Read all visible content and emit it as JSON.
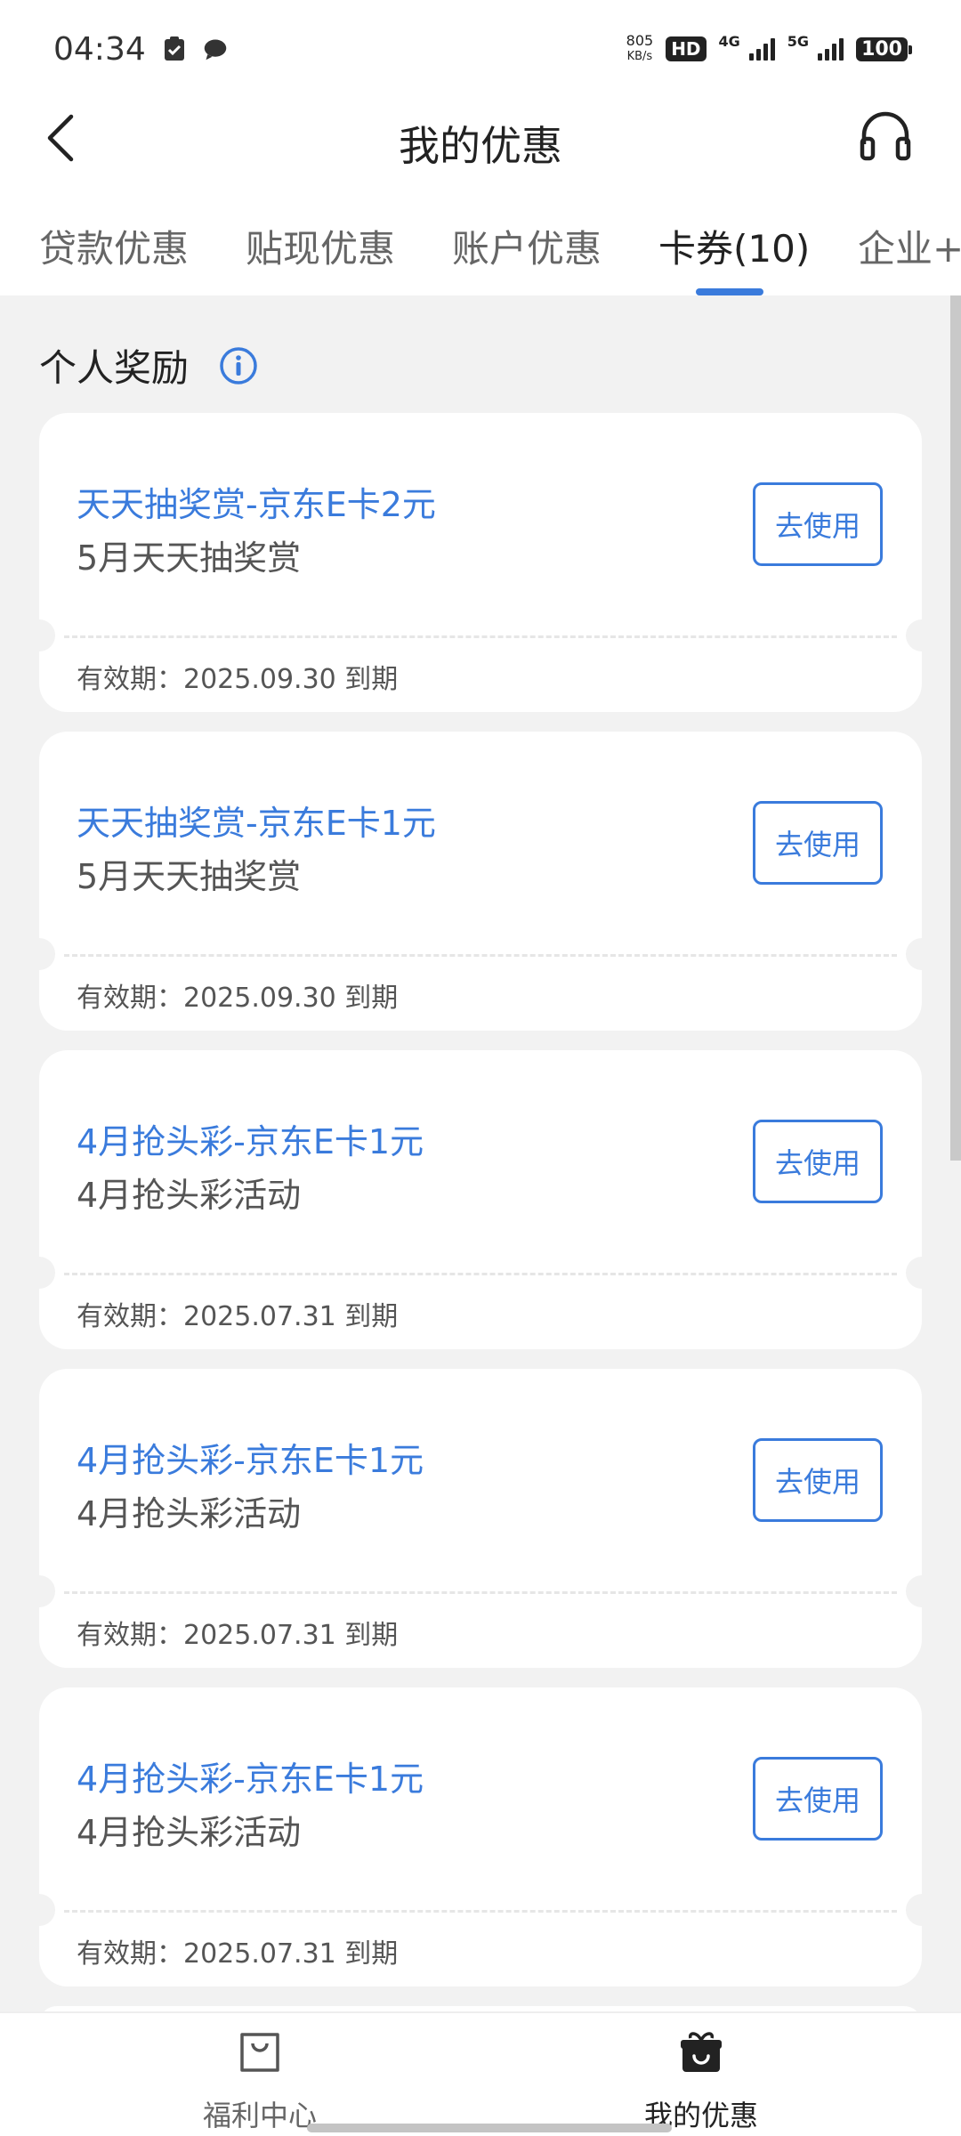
{
  "status_bar": {
    "time": "04:34",
    "net_speed_value": "805",
    "net_speed_unit": "KB/s",
    "hd_label": "HD",
    "sim1_label": "4G",
    "sim2_label": "5G",
    "battery": "100"
  },
  "header": {
    "title": "我的优惠"
  },
  "tabs": [
    {
      "label": "贷款优惠",
      "active": false
    },
    {
      "label": "贴现优惠",
      "active": false
    },
    {
      "label": "账户优惠",
      "active": false
    },
    {
      "label": "卡券(10)",
      "active": true
    },
    {
      "label": "企业+",
      "active": false
    }
  ],
  "section": {
    "title": "个人奖励"
  },
  "coupons": [
    {
      "title": "天天抽奖赏-京东E卡2元",
      "subtitle": "5月天天抽奖赏",
      "validity": "有效期：2025.09.30 到期",
      "button": "去使用"
    },
    {
      "title": "天天抽奖赏-京东E卡1元",
      "subtitle": "5月天天抽奖赏",
      "validity": "有效期：2025.09.30 到期",
      "button": "去使用"
    },
    {
      "title": "4月抢头彩-京东E卡1元",
      "subtitle": "4月抢头彩活动",
      "validity": "有效期：2025.07.31 到期",
      "button": "去使用"
    },
    {
      "title": "4月抢头彩-京东E卡1元",
      "subtitle": "4月抢头彩活动",
      "validity": "有效期：2025.07.31 到期",
      "button": "去使用"
    },
    {
      "title": "4月抢头彩-京东E卡1元",
      "subtitle": "4月抢头彩活动",
      "validity": "有效期：2025.07.31 到期",
      "button": "去使用"
    }
  ],
  "bottom_nav": [
    {
      "label": "福利中心",
      "icon": "shopping-bag-icon",
      "active": false
    },
    {
      "label": "我的优惠",
      "icon": "gift-icon",
      "active": true
    }
  ],
  "colors": {
    "accent": "#3a7bdc",
    "background": "#f2f2f2"
  }
}
